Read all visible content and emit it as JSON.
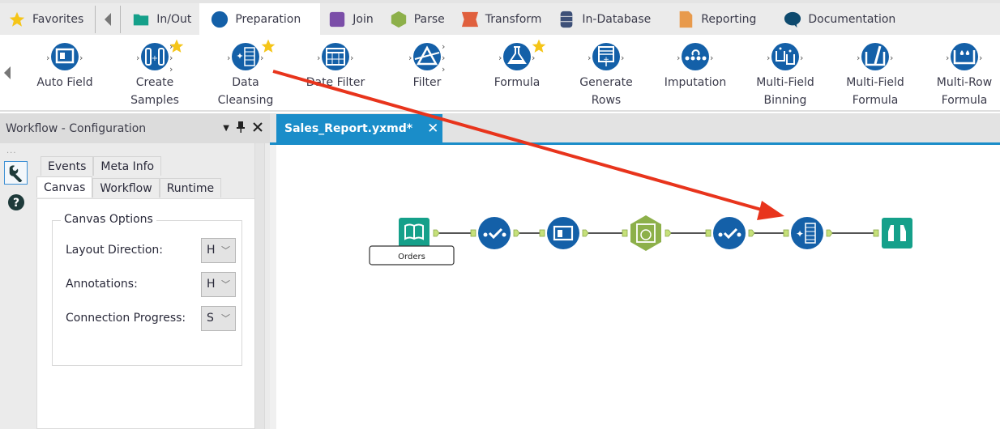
{
  "category_tabs": [
    {
      "label": "Favorites",
      "icon": "star-icon",
      "color": "#f5c518"
    },
    {
      "label": "In/Out",
      "icon": "folder-icon",
      "color": "#15a08a"
    },
    {
      "label": "Preparation",
      "icon": "circle-icon",
      "color": "#1460a8",
      "active": true
    },
    {
      "label": "Join",
      "icon": "square-icon",
      "color": "#7b4ea8"
    },
    {
      "label": "Parse",
      "icon": "hexagon-icon",
      "color": "#8db04a"
    },
    {
      "label": "Transform",
      "icon": "ribbon-icon",
      "color": "#e0603e"
    },
    {
      "label": "In-Database",
      "icon": "database-icon",
      "color": "#3d5078"
    },
    {
      "label": "Reporting",
      "icon": "document-icon",
      "color": "#e89a4c"
    },
    {
      "label": "Documentation",
      "icon": "speech-bubble-icon",
      "color": "#0e4a6e"
    }
  ],
  "palette_tools": [
    {
      "label_line1": "Auto Field",
      "label_line2": "",
      "icon": "auto-field-icon",
      "favorite": false
    },
    {
      "label_line1": "Create",
      "label_line2": "Samples",
      "icon": "create-samples-icon",
      "favorite": true
    },
    {
      "label_line1": "Data",
      "label_line2": "Cleansing",
      "icon": "data-cleansing-icon",
      "favorite": true
    },
    {
      "label_line1": "Date Filter",
      "label_line2": "",
      "icon": "date-filter-icon",
      "favorite": false
    },
    {
      "label_line1": "Filter",
      "label_line2": "",
      "icon": "filter-icon",
      "favorite": false
    },
    {
      "label_line1": "Formula",
      "label_line2": "",
      "icon": "formula-icon",
      "favorite": true
    },
    {
      "label_line1": "Generate",
      "label_line2": "Rows",
      "icon": "generate-rows-icon",
      "favorite": false
    },
    {
      "label_line1": "Imputation",
      "label_line2": "",
      "icon": "imputation-icon",
      "favorite": false
    },
    {
      "label_line1": "Multi-Field",
      "label_line2": "Binning",
      "icon": "multi-field-binning-icon",
      "favorite": false
    },
    {
      "label_line1": "Multi-Field",
      "label_line2": "Formula",
      "icon": "multi-field-formula-icon",
      "favorite": false
    },
    {
      "label_line1": "Multi-Row",
      "label_line2": "Formula",
      "icon": "multi-row-formula-icon",
      "favorite": false
    }
  ],
  "config_panel": {
    "title": "Workflow - Configuration",
    "dots": "...",
    "tabs_row1": [
      "Events",
      "Meta Info"
    ],
    "tabs_row2": [
      "Canvas",
      "Workflow",
      "Runtime"
    ],
    "active_tab": "Canvas",
    "group_title": "Canvas Options",
    "fields": [
      {
        "label": "Layout Direction:",
        "value": "H"
      },
      {
        "label": "Annotations:",
        "value": "H"
      },
      {
        "label": "Connection Progress:",
        "value": "S"
      }
    ]
  },
  "document": {
    "tab_title": "Sales_Report.yxmd*",
    "close_glyph": "✕"
  },
  "workflow": {
    "nodes": [
      {
        "type": "input",
        "icon": "book-icon",
        "annotation": "Orders"
      },
      {
        "type": "select",
        "icon": "select-check-icon"
      },
      {
        "type": "auto-field",
        "icon": "auto-field-icon"
      },
      {
        "type": "datetime",
        "icon": "datetime-icon"
      },
      {
        "type": "select",
        "icon": "select-check-icon"
      },
      {
        "type": "data-cleansing",
        "icon": "data-cleansing-icon"
      },
      {
        "type": "browse",
        "icon": "binoculars-icon"
      }
    ]
  },
  "colors": {
    "prep_blue": "#1460a8",
    "accent_blue": "#1a8dc9",
    "io_teal": "#15a08a",
    "parse_green": "#8db04a",
    "arrow_red": "#e8341c",
    "star_yellow": "#f5c518"
  }
}
